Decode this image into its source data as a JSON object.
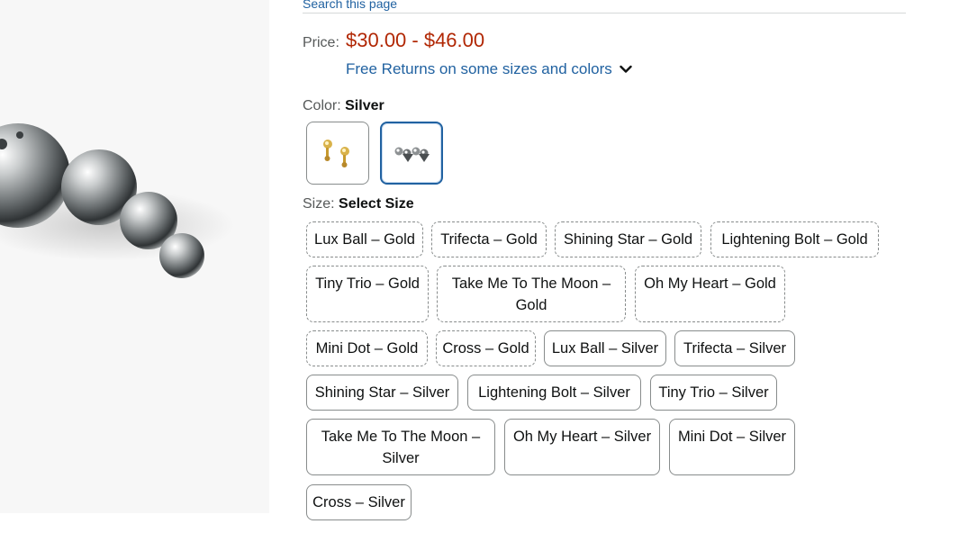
{
  "header": {
    "search_link": "Search this page"
  },
  "price": {
    "label": "Price:",
    "value": "$30.00 - $46.00"
  },
  "returns": {
    "text": "Free Returns on some sizes and colors",
    "icon": "chevron-down-icon"
  },
  "color": {
    "label": "Color: ",
    "selected": "Silver",
    "swatches": [
      {
        "name": "Gold",
        "selected": false
      },
      {
        "name": "Silver",
        "selected": true
      }
    ]
  },
  "size": {
    "label": "Size: ",
    "selected": "Select Size",
    "options": [
      {
        "label": "Lux Ball – Gold",
        "available": false
      },
      {
        "label": "Trifecta – Gold",
        "available": false
      },
      {
        "label": "Shining Star – Gold",
        "available": false
      },
      {
        "label": "Lightening Bolt – Gold",
        "available": false
      },
      {
        "label": "Tiny Trio – Gold",
        "available": false
      },
      {
        "label": "Take Me To The Moon – Gold",
        "available": false
      },
      {
        "label": "Oh My Heart – Gold",
        "available": false
      },
      {
        "label": "Mini Dot – Gold",
        "available": false
      },
      {
        "label": "Cross – Gold",
        "available": false
      },
      {
        "label": "Lux Ball – Silver",
        "available": true
      },
      {
        "label": "Trifecta – Silver",
        "available": true
      },
      {
        "label": "Shining Star – Silver",
        "available": true
      },
      {
        "label": "Lightening Bolt – Silver",
        "available": true
      },
      {
        "label": "Tiny Trio – Silver",
        "available": true
      },
      {
        "label": "Take Me To The Moon – Silver",
        "available": true
      },
      {
        "label": "Oh My Heart – Silver",
        "available": true
      },
      {
        "label": "Mini Dot – Silver",
        "available": true
      },
      {
        "label": "Cross – Silver",
        "available": true
      }
    ]
  },
  "colors": {
    "price": "#b12704",
    "link": "#2162a1",
    "selected_border": "#2162a1"
  }
}
